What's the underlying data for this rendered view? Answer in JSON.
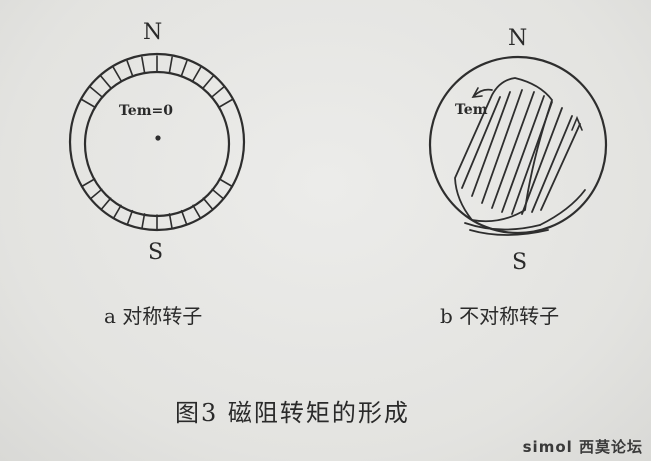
{
  "labels": {
    "left_north": "N",
    "left_south": "S",
    "left_torque": "Tem=0",
    "right_north": "N",
    "right_south": "S",
    "right_torque": "Tem"
  },
  "captions": {
    "a": "a 对称转子",
    "b": "b 不对称转子"
  },
  "figure_title": "图3 磁阻转矩的形成",
  "watermark": "simol 西莫论坛",
  "ink_color": "#2a2a2a"
}
